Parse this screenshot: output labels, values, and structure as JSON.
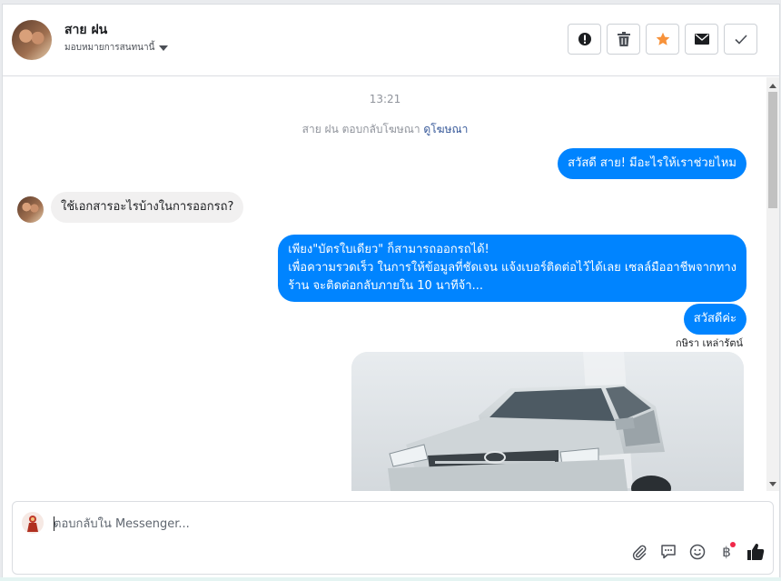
{
  "header": {
    "contact_name": "สาย ฝน",
    "assign_label": "มอบหมายการสนทนานี้",
    "actions": [
      {
        "name": "spam-button",
        "icon": "exclamation-icon"
      },
      {
        "name": "delete-button",
        "icon": "trash-icon"
      },
      {
        "name": "star-button",
        "icon": "star-icon"
      },
      {
        "name": "mark-unread-button",
        "icon": "envelope-icon"
      },
      {
        "name": "done-button",
        "icon": "check-icon"
      }
    ],
    "star_color": "#f7923a"
  },
  "thread": {
    "time": "13:21",
    "replied_text": "สาย ฝน ตอบกลับโฆษณา",
    "replied_link": "ดูโฆษณา",
    "messages": [
      {
        "dir": "out",
        "text": "สวัสดี สาย! มีอะไรให้เราช่วยไหม"
      },
      {
        "dir": "in",
        "text": "ใช้เอกสารอะไรบ้างในการออกรถ?"
      },
      {
        "dir": "out",
        "lines": [
          "เพียง\"บัตรใบเดียว\" ก็สามารถออกรถได้!",
          "เพื่อความรวดเร็ว ในการให้ข้อมูลที่ชัดเจน แจ้งเบอร์ติดต่อไว้ได้เลย เซลล์มืออาชีพจากทาง",
          "ร้าน จะติดต่อกลับภายใน 10 นาทีจ้า..."
        ]
      },
      {
        "dir": "out",
        "text": "สวัสดีค่ะ"
      }
    ],
    "sender_name": "กษิรา เหล่ารัตน์",
    "out_color": "#0084ff",
    "in_color": "#f1f0f0"
  },
  "composer": {
    "placeholder": "ตอบกลับใน Messenger...",
    "tools": [
      "paperclip-icon",
      "saved-reply-icon",
      "emoji-icon",
      "baht-icon",
      "thumbs-up-icon"
    ],
    "baht_symbol": "฿"
  }
}
